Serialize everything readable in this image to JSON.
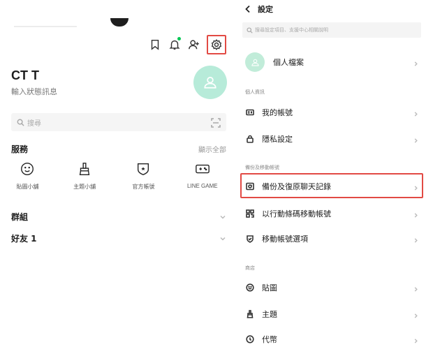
{
  "left": {
    "header_icons": [
      "bookmark-icon",
      "bell-icon",
      "add-friend-icon",
      "gear-icon"
    ],
    "profile": {
      "name": "CT T",
      "status": "輸入狀態訊息"
    },
    "search": {
      "placeholder": "搜尋"
    },
    "services": {
      "title": "服務",
      "show_all": "顯示全部",
      "items": [
        {
          "label": "貼圖小舖",
          "icon": "smiley-icon"
        },
        {
          "label": "主題小舖",
          "icon": "brush-icon"
        },
        {
          "label": "官方帳號",
          "icon": "shield-star-icon"
        },
        {
          "label": "LINE GAME",
          "icon": "gamepad-icon"
        }
      ]
    },
    "groups_label": "群組",
    "friends_label": "好友 1"
  },
  "right": {
    "title": "設定",
    "search_placeholder": "搜尋設定項目、支援中心相關說明",
    "profile_row": "個人檔案",
    "section_personal": "個人資訊",
    "my_account": "我的帳號",
    "privacy": "隱私設定",
    "section_backup": "備份及移動帳號",
    "backup_restore": "備份及復原聊天記錄",
    "qr_transfer": "以行動條碼移動帳號",
    "transfer_options": "移動帳號選項",
    "section_shop": "商店",
    "stickers": "貼圖",
    "themes": "主題",
    "coins": "代幣"
  },
  "colors": {
    "highlight": "#e24a44",
    "line_green": "#06c755",
    "avatar_green": "#b7ebd9"
  }
}
